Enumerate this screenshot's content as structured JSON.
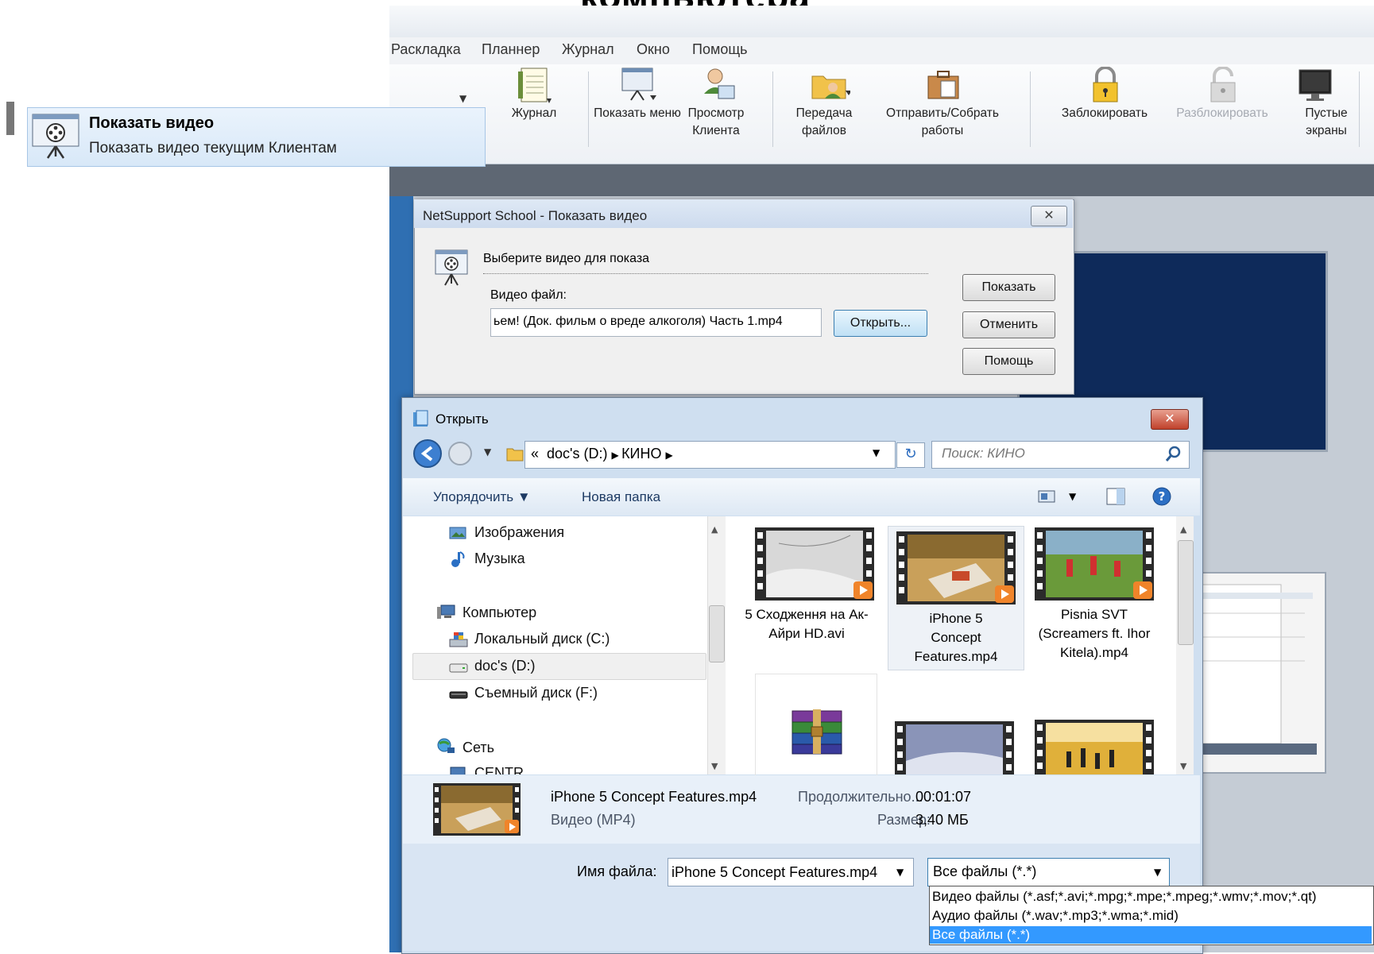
{
  "slide": {
    "title_fragment": "компьютера"
  },
  "menubar": {
    "items": [
      "Раскладка",
      "Планнер",
      "Журнал",
      "Окно",
      "Помощь"
    ]
  },
  "toolbar": {
    "buttons": [
      {
        "label": "Журнал",
        "icon": "journal-icon"
      },
      {
        "label": "Показать меню",
        "icon": "show-presentation-icon"
      },
      {
        "label": "Просмотр Клиента",
        "icon": "client-view-icon"
      },
      {
        "label": "Передача файлов",
        "icon": "file-transfer-icon"
      },
      {
        "label": "Отправить/Собрать работы",
        "icon": "send-collect-icon"
      },
      {
        "label": "Заблокировать",
        "icon": "lock-icon"
      },
      {
        "label": "Разблокировать",
        "icon": "unlock-icon",
        "disabled": true
      },
      {
        "label": "Пустые экраны",
        "icon": "blank-screen-icon"
      }
    ]
  },
  "callout": {
    "title": "Показать видео",
    "description": "Показать видео текущим Клиентам",
    "icon": "show-video-icon"
  },
  "video_dialog": {
    "title": "NetSupport School - Показать видео",
    "section_label": "Выберите видео для показа",
    "field_label": "Видео файл:",
    "field_value": "ьем! (Док. фильм о вреде алкоголя) Часть 1.mp4",
    "open_button": "Открыть...",
    "show_button": "Показать",
    "cancel_button": "Отменить",
    "help_button": "Помощь"
  },
  "open_dialog": {
    "title": "Открыть",
    "address": {
      "prefix": "«",
      "parts": [
        "doc's (D:)",
        "КИНО"
      ]
    },
    "search_placeholder": "Поиск: КИНО",
    "organize_label": "Упорядочить ▼",
    "new_folder_label": "Новая папка",
    "nav_items": [
      {
        "label": "Изображения",
        "icon": "pictures-icon",
        "indent": 1
      },
      {
        "label": "Музыка",
        "icon": "music-icon",
        "indent": 1
      },
      {
        "label": "Компьютер",
        "icon": "computer-icon",
        "indent": 0
      },
      {
        "label": "Локальный диск (C:)",
        "icon": "drive-icon",
        "indent": 1
      },
      {
        "label": "doc's (D:)",
        "icon": "drive-icon",
        "indent": 1,
        "selected": true
      },
      {
        "label": "Съемный диск (F:)",
        "icon": "removable-drive-icon",
        "indent": 1
      },
      {
        "label": "Сеть",
        "icon": "network-icon",
        "indent": 0
      },
      {
        "label": "CENTR",
        "icon": "pc-icon",
        "indent": 1
      }
    ],
    "files": [
      {
        "name": "5 Сходження на Ак-Айри HD.avi"
      },
      {
        "name": "iPhone 5 Concept Features.mp4",
        "selected": true
      },
      {
        "name": "Pisnia SVT (Screamers ft. Ihor Kitela).mp4"
      }
    ],
    "details": {
      "filename": "iPhone 5 Concept Features.mp4",
      "type": "Видео (MP4)",
      "duration_label": "Продолжительно...",
      "duration_value": "00:01:07",
      "size_label": "Размер:",
      "size_value": "3,40 МБ"
    },
    "filename_label": "Имя файла:",
    "filename_value": "iPhone 5 Concept Features.mp4",
    "filetype_value": "Все файлы (*.*)",
    "filetype_options": [
      "Видео файлы (*.asf;*.avi;*.mpg;*.mpe;*.mpeg;*.wmv;*.mov;*.qt)",
      "Аудио файлы (*.wav;*.mp3;*.wma;*.mid)",
      "Все файлы (*.*)"
    ]
  },
  "colors": {
    "accent": "#3399ff",
    "close_red": "#c0412b",
    "workspace_blue": "#0e2a5a"
  }
}
